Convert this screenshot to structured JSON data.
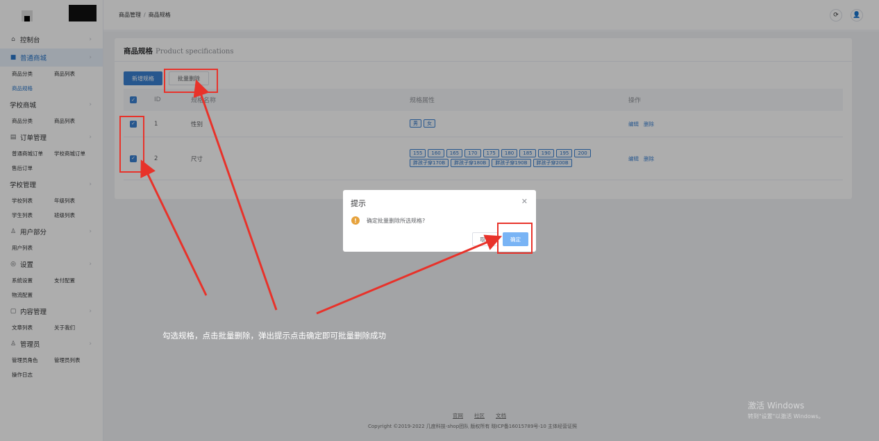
{
  "sidebar": {
    "groups": [
      {
        "label": "控制台",
        "icon": "home-icon",
        "subs": []
      },
      {
        "label": "普通商城",
        "icon": "shop-icon",
        "active": true,
        "subs": [
          [
            "商品分类",
            "商品列表"
          ],
          [
            "商品规格"
          ]
        ]
      },
      {
        "label": "学校商城",
        "icon": "",
        "subs": [
          [
            "商品分类",
            "商品列表"
          ]
        ]
      },
      {
        "label": "订单管理",
        "icon": "order-icon",
        "subs": [
          [
            "普通商城订单",
            "学校商城订单"
          ],
          [
            "售后订单"
          ]
        ]
      },
      {
        "label": "学校管理",
        "icon": "",
        "subs": [
          [
            "学校列表",
            "年级列表"
          ],
          [
            "学生列表",
            "班级列表"
          ]
        ]
      },
      {
        "label": "用户部分",
        "icon": "user-icon",
        "subs": [
          [
            "用户列表"
          ]
        ]
      },
      {
        "label": "设置",
        "icon": "settings-icon",
        "subs": [
          [
            "系统设置",
            "支付配置"
          ],
          [
            "物流配置"
          ]
        ]
      },
      {
        "label": "内容管理",
        "icon": "document-icon",
        "subs": [
          [
            "文章列表",
            "关于我们"
          ]
        ]
      },
      {
        "label": "管理员",
        "icon": "admin-icon",
        "subs": [
          [
            "管理员角色",
            "管理员列表"
          ],
          [
            "操作日志"
          ]
        ]
      }
    ]
  },
  "header": {
    "breadcrumb": [
      "商品管理",
      "商品规格"
    ]
  },
  "card": {
    "title": "商品规格",
    "title_en": "Product specifications",
    "add_button": "新增规格",
    "batch_delete_button": "批量删除"
  },
  "table": {
    "columns": [
      "ID",
      "规格名称",
      "规格属性",
      "操作"
    ],
    "rows": [
      {
        "id": "1",
        "name": "性别",
        "attrs": [
          "男",
          "女"
        ],
        "ops": [
          "编辑",
          "删除"
        ]
      },
      {
        "id": "2",
        "name": "尺寸",
        "attrs": [
          "155",
          "160",
          "165",
          "170",
          "175",
          "180",
          "185",
          "190",
          "195",
          "200",
          "胖孩子穿170B",
          "胖孩子穿180B",
          "胖孩子穿190B",
          "胖孩子穿200B"
        ],
        "ops": [
          "编辑",
          "删除"
        ]
      }
    ]
  },
  "modal": {
    "title": "提示",
    "message": "确定批量删除所选规格?",
    "cancel": "取消",
    "confirm": "确定"
  },
  "footer": {
    "links": [
      "官网",
      "社区",
      "文档"
    ],
    "copyright": "Copyright ©2019-2022 几度科技-shop团队 版权所有 晓ICP备16015789号-10 主体经营证照"
  },
  "annotation": "勾选规格，点击批量删除，弹出提示点击确定即可批量删除成功",
  "watermark": {
    "title": "激活 Windows",
    "sub": "转到\"设置\"以激活 Windows。"
  },
  "colors": {
    "primary": "#3a80d2",
    "annotation_red": "#e8322a",
    "warning": "#e6a23c"
  }
}
